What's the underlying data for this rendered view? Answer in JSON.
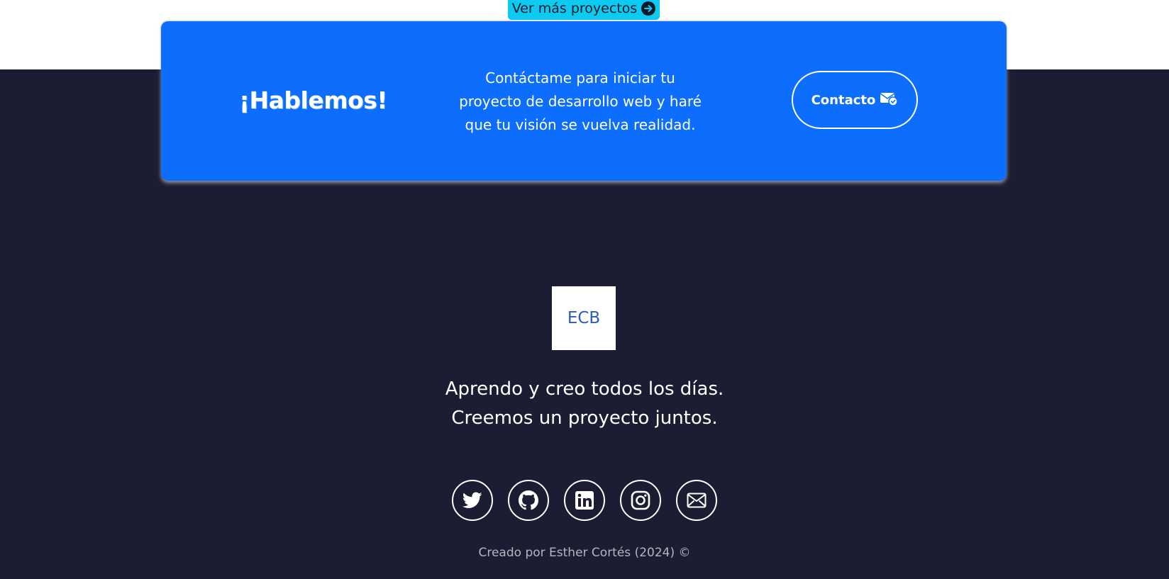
{
  "projects": {
    "more_label": "Ver más proyectos",
    "more_icon": "arrow-right-circle-icon"
  },
  "cta": {
    "title": "¡Hablemos!",
    "text": "Contáctame para iniciar tu proyecto de desarrollo web y haré que tu visión se vuelva realidad.",
    "button_label": "Contacto",
    "button_icon": "envelope-check-icon",
    "color": "#0d6efd"
  },
  "footer": {
    "logo_text": "ECB",
    "tagline_line1": "Aprendo y creo todos los días.",
    "tagline_line2": "Creemos un proyecto juntos.",
    "socials": [
      "twitter-icon",
      "github-icon",
      "linkedin-icon",
      "instagram-icon",
      "envelope-icon"
    ],
    "copyright": "Creado por Esther Cortés (2024) ©",
    "background": "#1c1d33"
  }
}
